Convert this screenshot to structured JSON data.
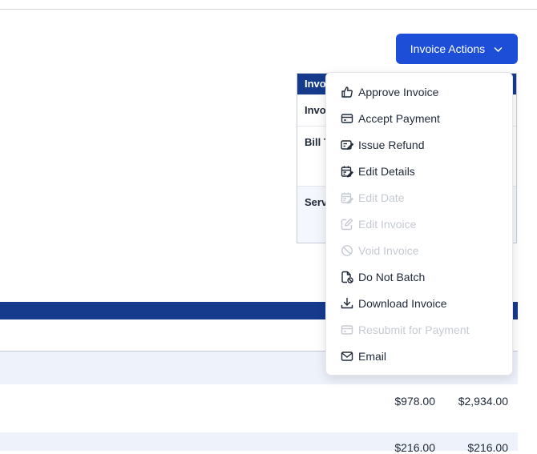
{
  "header": {
    "actions_label": "Invoice Actions"
  },
  "summary": {
    "heading": "Invo",
    "rows": [
      "Invo",
      "Bill T",
      "Serv"
    ]
  },
  "menu": {
    "items": [
      {
        "label": "Approve Invoice",
        "icon": "thumbs-up-icon",
        "enabled": true
      },
      {
        "label": "Accept Payment",
        "icon": "credit-card-icon",
        "enabled": true
      },
      {
        "label": "Issue Refund",
        "icon": "refund-card-icon",
        "enabled": true
      },
      {
        "label": "Edit Details",
        "icon": "calendar-edit-icon",
        "enabled": true
      },
      {
        "label": "Edit Date",
        "icon": "calendar-edit-icon",
        "enabled": false
      },
      {
        "label": "Edit Invoice",
        "icon": "pencil-square-icon",
        "enabled": false
      },
      {
        "label": "Void Invoice",
        "icon": "ban-icon",
        "enabled": false
      },
      {
        "label": "Do Not Batch",
        "icon": "file-block-icon",
        "enabled": true
      },
      {
        "label": "Download Invoice",
        "icon": "download-icon",
        "enabled": true
      },
      {
        "label": "Resubmit for Payment",
        "icon": "credit-card-icon",
        "enabled": false
      },
      {
        "label": "Email",
        "icon": "envelope-icon",
        "enabled": true
      }
    ]
  },
  "table": {
    "rows": [
      {
        "rate": "$978.00",
        "total": "$2,934.00"
      },
      {
        "rate": "$216.00",
        "total": "$216.00"
      }
    ]
  }
}
